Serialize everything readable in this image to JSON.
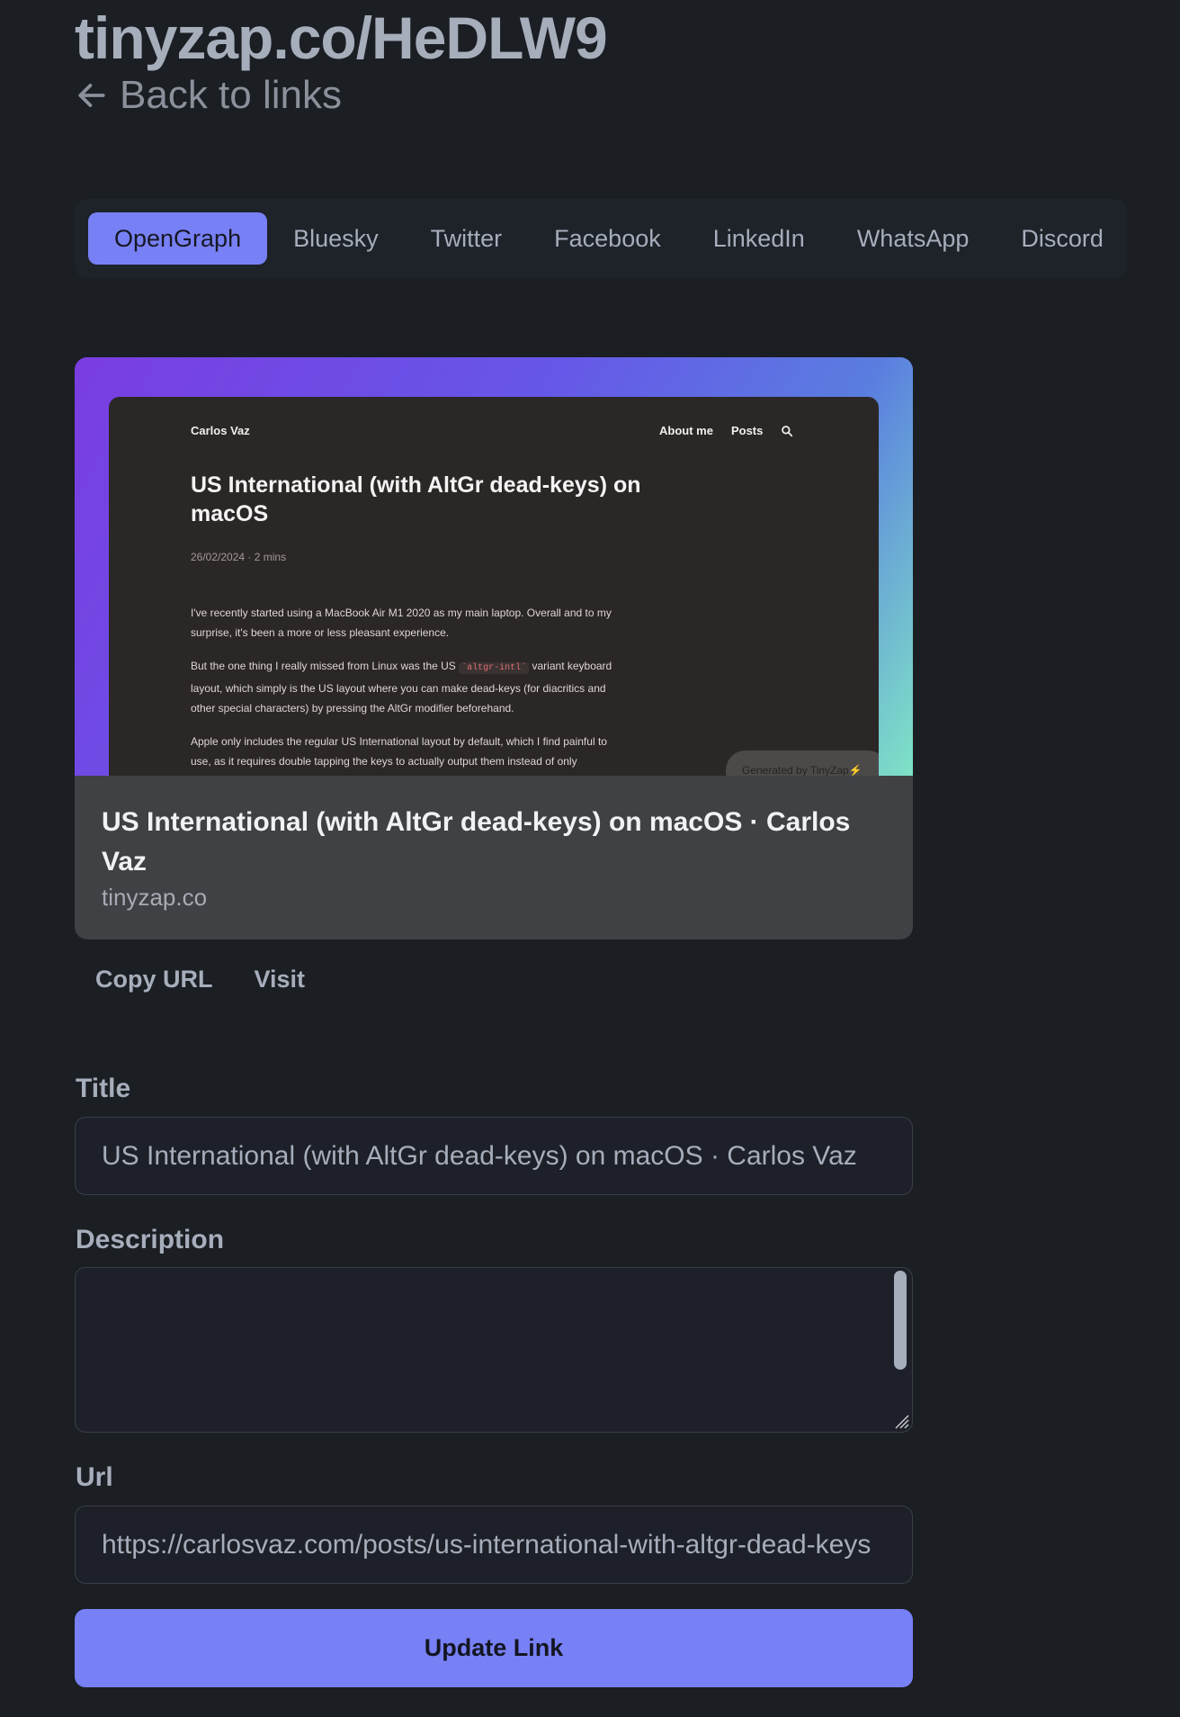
{
  "header": {
    "title": "tinyzap.co/HeDLW9",
    "back_label": "Back to links"
  },
  "tabs": [
    {
      "label": "OpenGraph",
      "active": true
    },
    {
      "label": "Bluesky"
    },
    {
      "label": "Twitter"
    },
    {
      "label": "Facebook"
    },
    {
      "label": "LinkedIn"
    },
    {
      "label": "WhatsApp"
    },
    {
      "label": "Discord"
    }
  ],
  "preview": {
    "screenshot": {
      "author": "Carlos Vaz",
      "nav_about": "About me",
      "nav_posts": "Posts",
      "heading": "US International (with AltGr dead-keys) on macOS",
      "meta": "26/02/2024 · 2 mins",
      "para1": "I've recently started using a MacBook Air M1 2020 as my main laptop. Overall and to my surprise, it's been a more or less pleasant experience.",
      "para2_before": "But the one thing I really missed from Linux was the US ",
      "para2_code": "`altgr-intl`",
      "para2_after": " variant keyboard layout, which simply is the US layout where you can make dead-keys (for diacritics and other special characters) by pressing the AltGr modifier beforehand.",
      "para3": "Apple only includes the regular US International layout by default, which I find painful to use, as it requires double tapping the keys to actually output them instead of only",
      "badge": "Generated by TinyZap⚡"
    },
    "title": "US International (with AltGr dead-keys) on macOS · Carlos Vaz",
    "domain": "tinyzap.co"
  },
  "actions": {
    "copy_label": "Copy URL",
    "visit_label": "Visit"
  },
  "form": {
    "title_label": "Title",
    "title_value": "US International (with AltGr dead-keys) on macOS · Carlos Vaz",
    "description_label": "Description",
    "description_value": "",
    "url_label": "Url",
    "url_value": "https://carlosvaz.com/posts/us-international-with-altgr-dead-keys",
    "submit_label": "Update Link"
  },
  "colors": {
    "accent": "#7880f6",
    "background": "#1b1e23"
  }
}
